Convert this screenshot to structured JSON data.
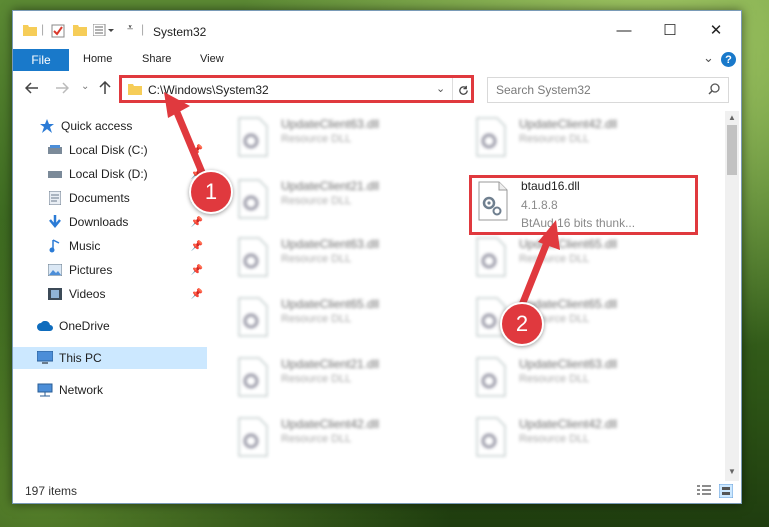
{
  "window": {
    "title": "System32",
    "minimize_glyph": "—",
    "maximize_glyph": "☐",
    "close_glyph": "✕"
  },
  "ribbon": {
    "tabs": [
      "File",
      "Home",
      "Share",
      "View"
    ],
    "expand_glyph": "⌄",
    "help_glyph": "?"
  },
  "address": {
    "path": "C:\\Windows\\System32",
    "search_placeholder": "Search System32"
  },
  "sidebar": {
    "items": [
      {
        "label": "Quick access",
        "icon": "star-icon",
        "pinned": false
      },
      {
        "label": "Local Disk (C:)",
        "icon": "drive-icon",
        "pinned": true
      },
      {
        "label": "Local Disk (D:)",
        "icon": "drive-icon",
        "pinned": true
      },
      {
        "label": "Documents",
        "icon": "documents-icon",
        "pinned": true
      },
      {
        "label": "Downloads",
        "icon": "download-icon",
        "pinned": true
      },
      {
        "label": "Music",
        "icon": "music-icon",
        "pinned": true
      },
      {
        "label": "Pictures",
        "icon": "pictures-icon",
        "pinned": true
      },
      {
        "label": "Videos",
        "icon": "videos-icon",
        "pinned": true
      },
      {
        "label": "OneDrive",
        "icon": "cloud-icon",
        "pinned": false
      },
      {
        "label": "This PC",
        "icon": "computer-icon",
        "pinned": false,
        "selected": true
      },
      {
        "label": "Network",
        "icon": "network-icon",
        "pinned": false
      }
    ]
  },
  "files": {
    "left_column": [
      {
        "name": "UpdateClient63.dll",
        "desc": "Resource DLL"
      },
      {
        "name": "UpdateClient21.dll",
        "desc": "Resource DLL"
      },
      {
        "name": "UpdateClient63.dll",
        "desc": "Resource DLL"
      },
      {
        "name": "UpdateClient65.dll",
        "desc": "Resource DLL"
      },
      {
        "name": "UpdateClient21.dll",
        "desc": "Resource DLL"
      },
      {
        "name": "UpdateClient42.dll",
        "desc": "Resource DLL"
      }
    ],
    "right_column": [
      {
        "name": "UpdateClient42.dll",
        "desc": "Resource DLL"
      },
      {
        "name": "UpdateClient65.dll",
        "desc": "Resource DLL"
      },
      {
        "name": "UpdateClient65.dll",
        "desc": "Resource DLL"
      },
      {
        "name": "UpdateClient63.dll",
        "desc": "Resource DLL"
      },
      {
        "name": "UpdateClient42.dll",
        "desc": "Resource DLL"
      }
    ],
    "highlighted": {
      "name": "btaud16.dll",
      "version": "4.1.8.8",
      "description": "BtAud 16 bits thunk..."
    }
  },
  "status": {
    "item_count": "197 items"
  },
  "callouts": [
    "1",
    "2"
  ],
  "colors": {
    "accent": "#1979ca",
    "highlight": "#e0393e",
    "selected_bg": "#cce8ff"
  }
}
